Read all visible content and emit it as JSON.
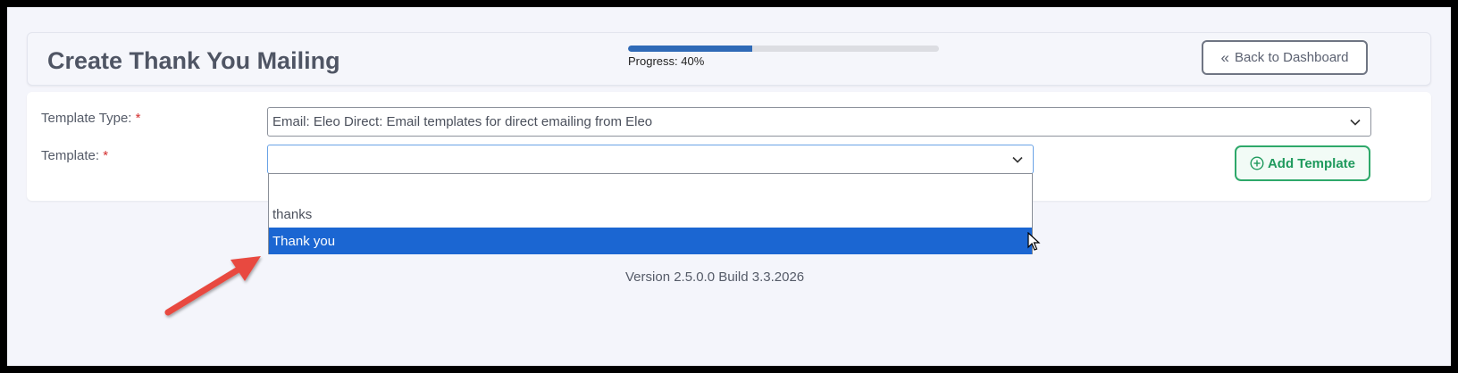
{
  "header": {
    "title": "Create Thank You Mailing",
    "progress_label": "Progress: 40%",
    "progress_fraction": 0.4,
    "back_button_label": "Back to Dashboard",
    "back_button_icon": "double-chevron-left-icon"
  },
  "form": {
    "template_type": {
      "label": "Template Type:",
      "required_mark": "*",
      "value": "Email: Eleo Direct: Email templates for direct emailing from Eleo"
    },
    "template": {
      "label": "Template:",
      "required_mark": "*",
      "value": "",
      "options": [
        "",
        "thanks",
        "Thank you"
      ],
      "highlighted_option": "Thank you"
    },
    "add_button_label": "Add Template",
    "add_button_icon": "plus-circle-icon"
  },
  "footer": {
    "version": "Version 2.5.0.0 Build 3.3.2026"
  },
  "colors": {
    "accent_blue": "#1b66d2",
    "progress_blue": "#2f6ab7",
    "success_green": "#2ea86a",
    "required_red": "#d32f2f",
    "annotation_arrow": "#e84a3f"
  }
}
